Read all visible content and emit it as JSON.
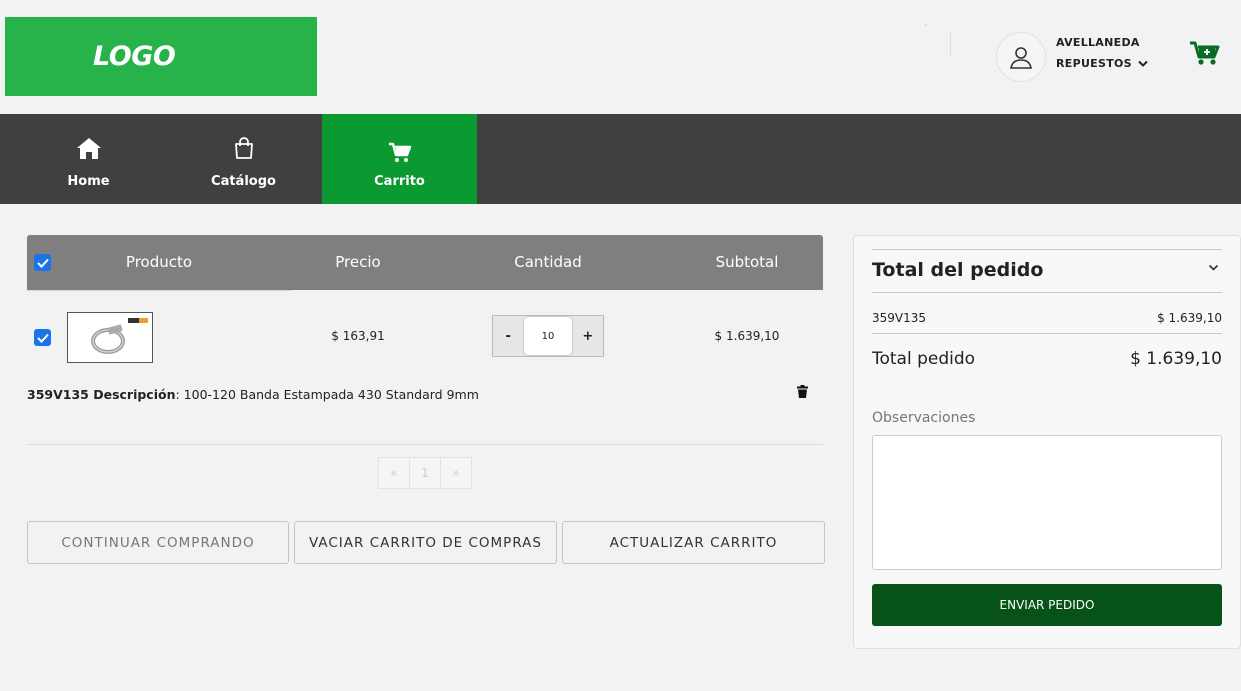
{
  "header": {
    "logo_text": "LOGO",
    "user_line1": "AVELLANEDA",
    "user_line2": "REPUESTOS",
    "user_icon": "user-icon",
    "cart_icon": "cart-plus-icon"
  },
  "nav": {
    "items": [
      {
        "label": "Home",
        "icon": "home-icon"
      },
      {
        "label": "Catálogo",
        "icon": "shopping-bag-icon"
      },
      {
        "label": "Carrito",
        "icon": "cart-icon",
        "active": true
      }
    ]
  },
  "cart": {
    "columns": [
      "Producto",
      "Precio",
      "Cantidad",
      "Subtotal"
    ],
    "items": [
      {
        "checked": true,
        "price": "$ 163,91",
        "quantity": "10",
        "subtotal": "$ 1.639,10",
        "code_label": "359V135 Descripción",
        "description": ": 100-120 Banda Estampada 430 Standard 9mm"
      }
    ],
    "qty_minus": "-",
    "qty_plus": "+",
    "pager": {
      "prev": "«",
      "page": "1",
      "next": "»"
    },
    "buttons": {
      "continue": "CONTINUAR COMPRANDO",
      "empty": "VACIAR CARRITO DE COMPRAS",
      "update": "ACTUALIZAR CARRITO"
    }
  },
  "summary": {
    "title": "Total del pedido",
    "line_code": "359V135",
    "line_amount": "$ 1.639,10",
    "total_label": "Total pedido",
    "total_amount": "$ 1.639,10",
    "obs_label": "Observaciones",
    "obs_value": "",
    "send_label": "ENVIAR PEDIDO"
  },
  "colors": {
    "brand_green": "#27b34a",
    "nav_active": "#0a9a31",
    "nav_bg": "#404040",
    "send_button": "#075218",
    "checkbox": "#1a73e8"
  }
}
